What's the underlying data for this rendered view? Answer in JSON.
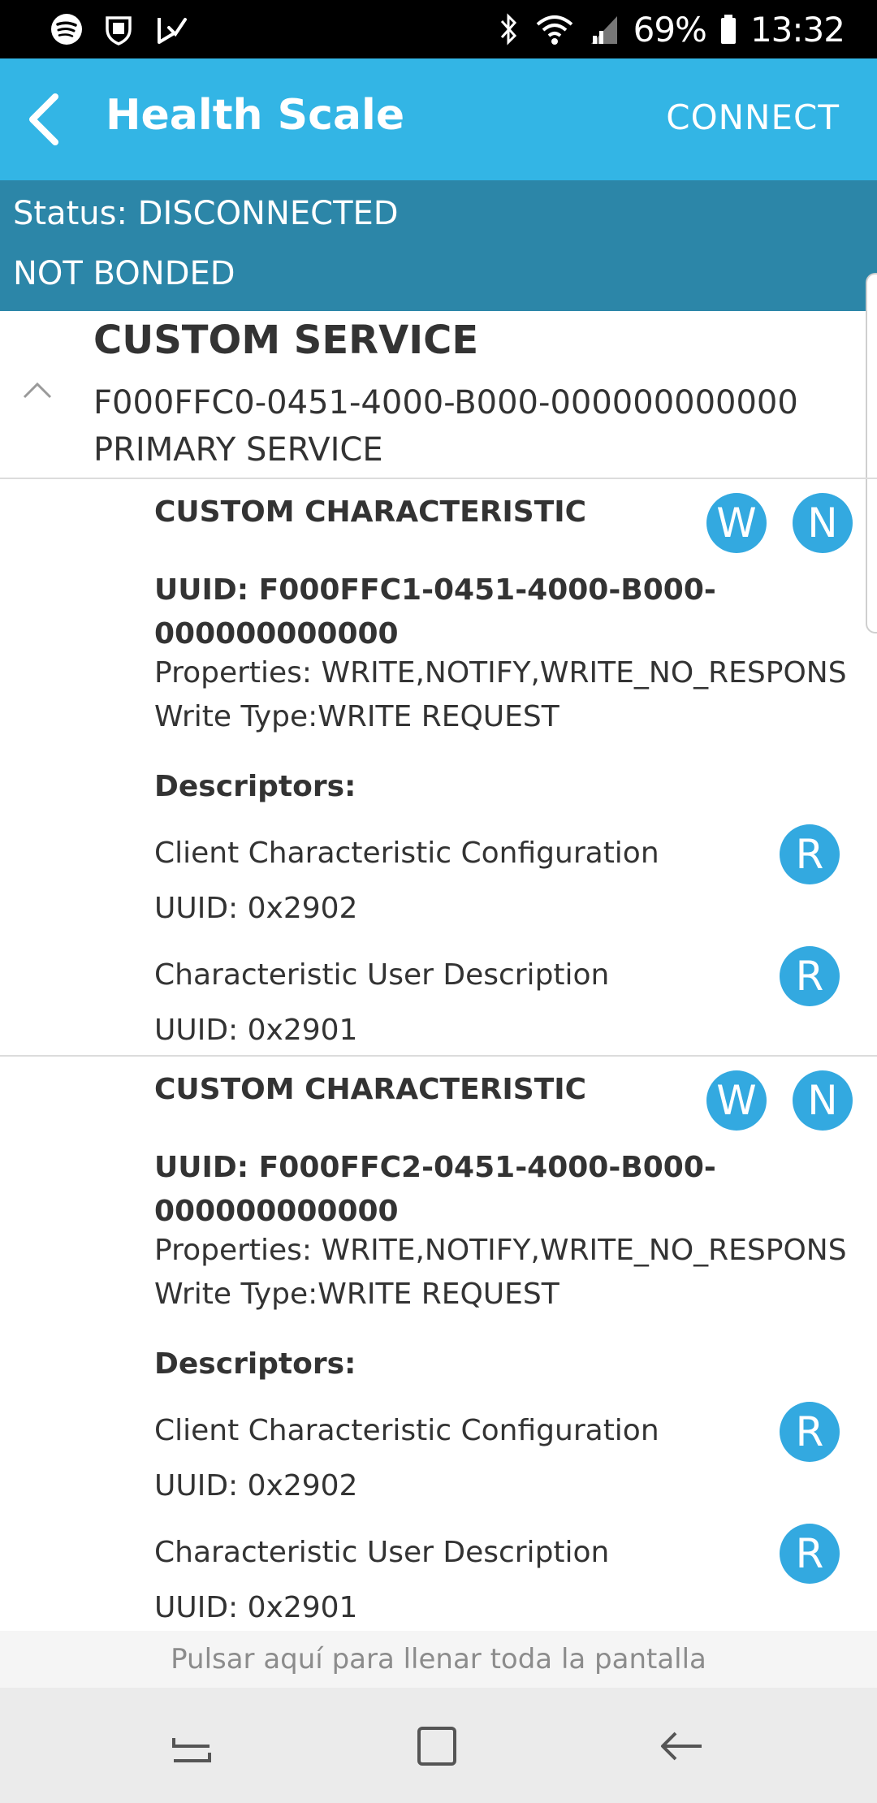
{
  "status_bar": {
    "left_icons": [
      "spotify-icon",
      "shield-icon",
      "play-check-icon"
    ],
    "right_icons": [
      "bluetooth-icon",
      "wifi-icon",
      "signal-icon",
      "battery-icon"
    ],
    "battery": "69%",
    "time": "13:32"
  },
  "app_bar": {
    "back_icon": "back-arrow-icon",
    "title": "Health Scale",
    "connect_label": "CONNECT",
    "color": "#33b5e5"
  },
  "status_panel": {
    "status": "Status: DISCONNECTED",
    "bond": "NOT BONDED",
    "color": "#2c86a8"
  },
  "service": {
    "title": "CUSTOM SERVICE",
    "uuid": "F000FFC0-0451-4000-B000-000000000000",
    "type": "PRIMARY SERVICE",
    "collapse_icon": "chevron-up-icon"
  },
  "characteristics": [
    {
      "title": "CUSTOM CHARACTERISTIC",
      "uuid": "UUID: F000FFC1-0451-4000-B000-000000000000",
      "properties": "Properties: WRITE,NOTIFY,WRITE_NO_RESPONS",
      "write_type": "Write Type:WRITE REQUEST",
      "buttons": [
        "W",
        "N"
      ],
      "descriptors_label": "Descriptors:",
      "descriptors": [
        {
          "name": "Client Characteristic Configuration",
          "uuid": "UUID: 0x2902",
          "button": "R"
        },
        {
          "name": "Characteristic User Description",
          "uuid": "UUID: 0x2901",
          "button": "R"
        }
      ]
    },
    {
      "title": "CUSTOM CHARACTERISTIC",
      "uuid": "UUID: F000FFC2-0451-4000-B000-000000000000",
      "properties": "Properties: WRITE,NOTIFY,WRITE_NO_RESPONS",
      "write_type": "Write Type:WRITE REQUEST",
      "buttons": [
        "W",
        "N"
      ],
      "descriptors_label": "Descriptors:",
      "descriptors": [
        {
          "name": "Client Characteristic Configuration",
          "uuid": "UUID: 0x2902",
          "button": "R"
        },
        {
          "name": "Characteristic User Description",
          "uuid": "UUID: 0x2901",
          "button": "R"
        }
      ]
    }
  ],
  "fullscreen_hint": "Pulsar aquí para llenar toda la pantalla",
  "nav_bar": {
    "icons": [
      "recent-apps-icon",
      "home-icon",
      "back-icon"
    ]
  }
}
